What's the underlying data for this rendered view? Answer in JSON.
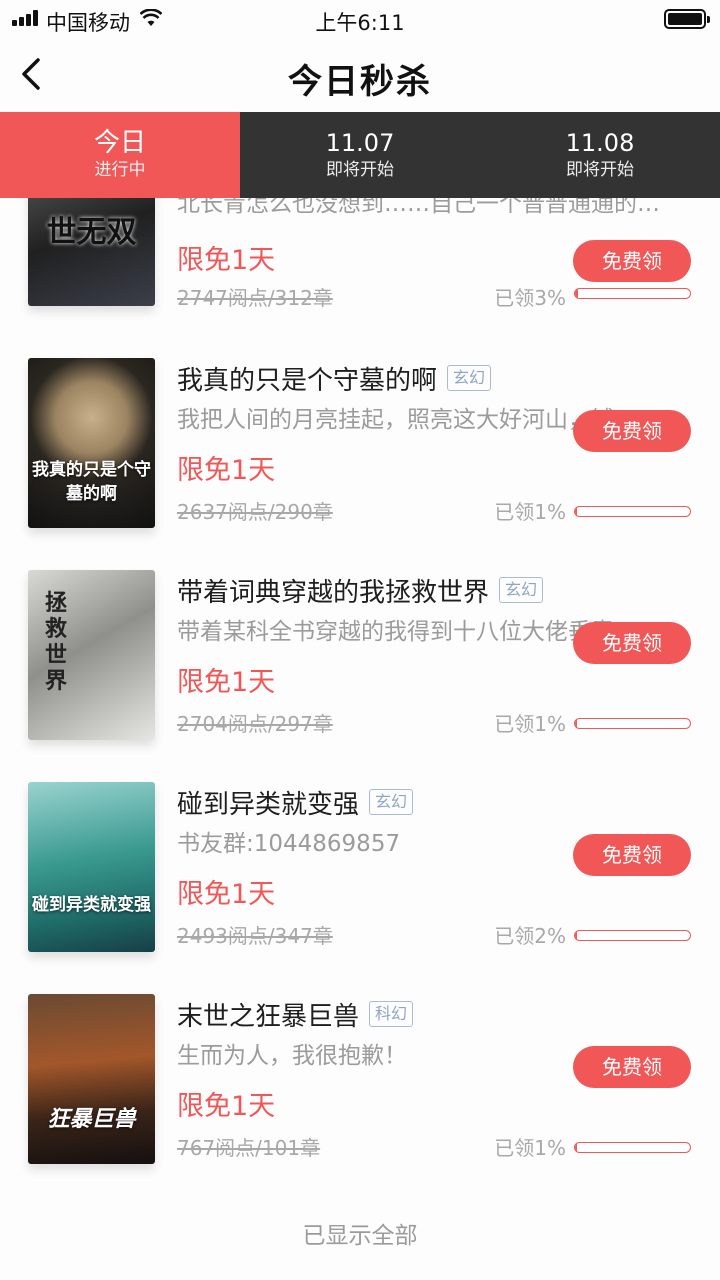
{
  "status_bar": {
    "carrier": "中国移动",
    "time": "上午6:11"
  },
  "nav": {
    "title": "今日秒杀"
  },
  "tabs": [
    {
      "main": "今日",
      "sub": "进行中"
    },
    {
      "main": "11.07",
      "sub": "即将开始"
    },
    {
      "main": "11.08",
      "sub": "即将开始"
    }
  ],
  "books": [
    {
      "title": "",
      "tag": "",
      "desc": "北长青怎么也没想到……自己一个普普通通的…",
      "promo": "限免1天",
      "orig": "2747阅点/312章",
      "claimed": "已领3%",
      "progress": 0.03,
      "btn": "免费领",
      "cover_text": "世无双",
      "cover_bg": "#3a3a3a"
    },
    {
      "title": "我真的只是个守墓的啊",
      "tag": "玄幻",
      "desc": "我把人间的月亮挂起，照亮这大好河山，铺…",
      "promo": "限免1天",
      "orig": "2637阅点/290章",
      "claimed": "已领1%",
      "progress": 0.01,
      "btn": "免费领",
      "cover_text": "我真的只是个守墓的啊",
      "cover_bg": "#2b2722"
    },
    {
      "title": "带着词典穿越的我拯救世界",
      "tag": "玄幻",
      "desc": "带着某科全书穿越的我得到十八位大佬垂青…",
      "promo": "限免1天",
      "orig": "2704阅点/297章",
      "claimed": "已领1%",
      "progress": 0.01,
      "btn": "免费领",
      "cover_text": "拯救世界",
      "cover_bg": "#9a9a98"
    },
    {
      "title": "碰到异类就变强",
      "tag": "玄幻",
      "desc": "书友群:1044869857",
      "promo": "限免1天",
      "orig": "2493阅点/347章",
      "claimed": "已领2%",
      "progress": 0.02,
      "btn": "免费领",
      "cover_text": "碰到异类就变强",
      "cover_bg": "#2f8c86"
    },
    {
      "title": "末世之狂暴巨兽",
      "tag": "科幻",
      "desc": "生而为人，我很抱歉！",
      "promo": "限免1天",
      "orig": "767阅点/101章",
      "claimed": "已领1%",
      "progress": 0.01,
      "btn": "免费领",
      "cover_text": "狂暴巨兽",
      "cover_bg": "#4a2c1c"
    }
  ],
  "footer": "已显示全部",
  "colors": {
    "accent": "#f25757",
    "tab_bg": "#333333",
    "muted": "#9b9b9b",
    "tag": "#8ea6c4"
  }
}
